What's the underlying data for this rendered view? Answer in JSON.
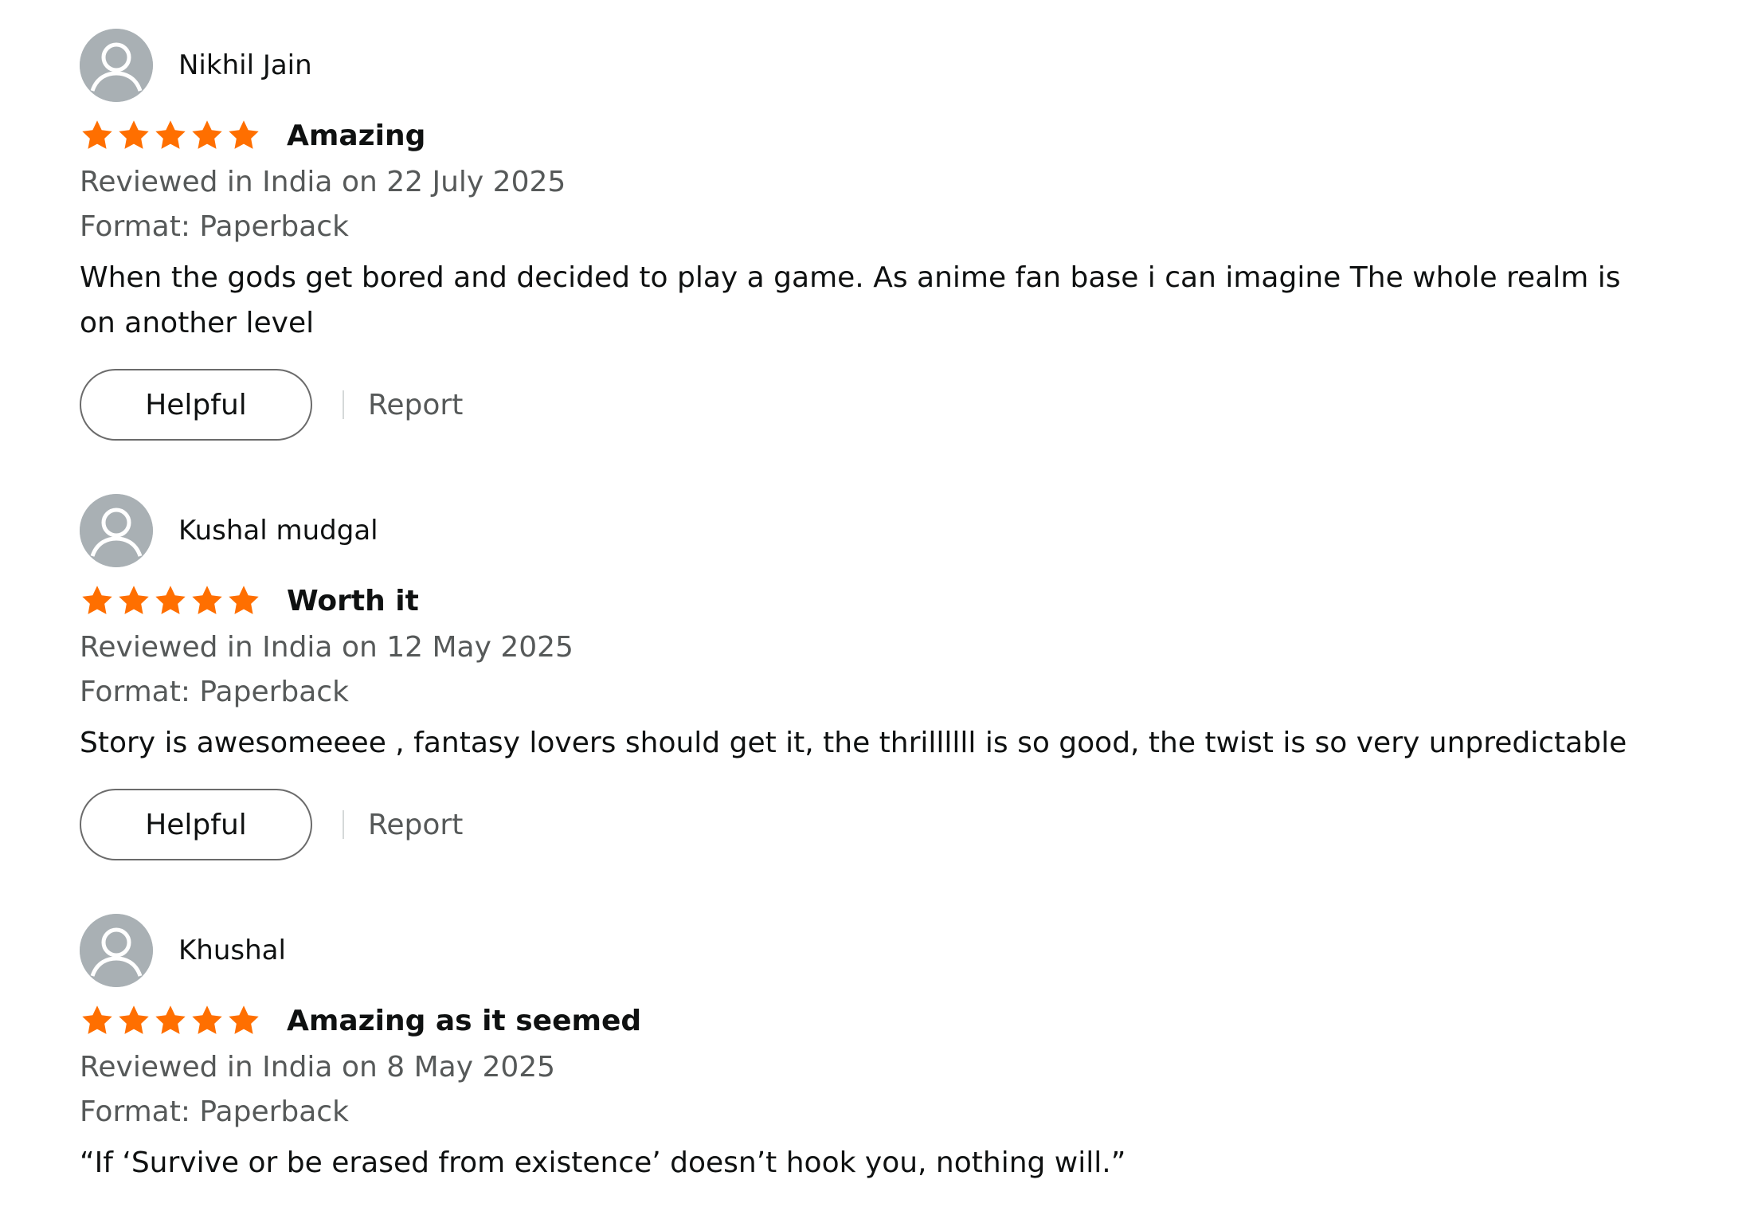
{
  "colors": {
    "star": "#ff6f00",
    "avatar_bg": "#a9b0b4",
    "text_primary": "#0f1111",
    "text_secondary": "#565959"
  },
  "reviews": [
    {
      "reviewer": "Nikhil Jain",
      "rating": 5,
      "rating_max": 5,
      "title": "Amazing",
      "date": "Reviewed in India on 22 July 2025",
      "format": "Format: Paperback",
      "body": "When the gods get bored and decided to play a game. As anime fan base i can imagine The whole realm is on another level",
      "helpful_label": "Helpful",
      "report_label": "Report"
    },
    {
      "reviewer": "Kushal mudgal",
      "rating": 5,
      "rating_max": 5,
      "title": "Worth it",
      "date": "Reviewed in India on 12 May 2025",
      "format": "Format: Paperback",
      "body": "Story is awesomeeee , fantasy lovers should get it, the thrillllll is so good, the twist is so very unpredictable",
      "helpful_label": "Helpful",
      "report_label": "Report"
    },
    {
      "reviewer": "Khushal",
      "rating": 5,
      "rating_max": 5,
      "title": "Amazing as it seemed",
      "date": "Reviewed in India on 8 May 2025",
      "format": "Format: Paperback",
      "body": "“If ‘Survive or be erased from existence’ doesn’t hook you, nothing will.”"
    }
  ],
  "icons": {
    "avatar": "user-silhouette-icon",
    "star": "star-filled-icon"
  }
}
